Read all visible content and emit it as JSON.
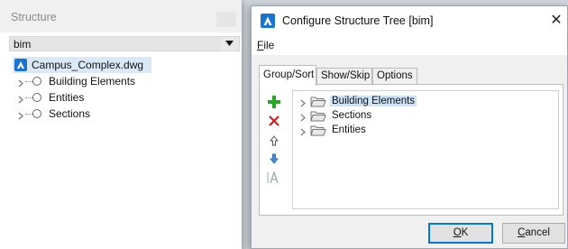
{
  "structure_panel": {
    "title": "Structure",
    "dropdown": {
      "value": "bim"
    },
    "root": {
      "label": "Campus_Complex.dwg"
    },
    "nodes": [
      {
        "label": "Building Elements"
      },
      {
        "label": "Entities"
      },
      {
        "label": "Sections"
      }
    ]
  },
  "dialog": {
    "title": "Configure Structure Tree [bim]",
    "close_label": "✕",
    "menu": {
      "file_prefix": "F",
      "file_rest": "ile"
    },
    "tabs": [
      {
        "label": "Group/Sort",
        "active": true
      },
      {
        "label": "Show/Skip",
        "active": false
      },
      {
        "label": "Options",
        "active": false
      }
    ],
    "tools": [
      "add-icon",
      "delete-icon",
      "move-up-icon",
      "move-down-icon",
      "text-format-icon"
    ],
    "tree": [
      {
        "label": "Building Elements",
        "selected": true
      },
      {
        "label": "Sections",
        "selected": false
      },
      {
        "label": "Entities",
        "selected": false
      }
    ],
    "ok": {
      "prefix": "O",
      "rest": "K"
    },
    "cancel": {
      "prefix": "C",
      "rest": "ancel"
    }
  },
  "colors": {
    "accent": "#1a73d2",
    "add": "#2aa52a",
    "delete": "#d02020",
    "selection": "#cde3f7"
  }
}
